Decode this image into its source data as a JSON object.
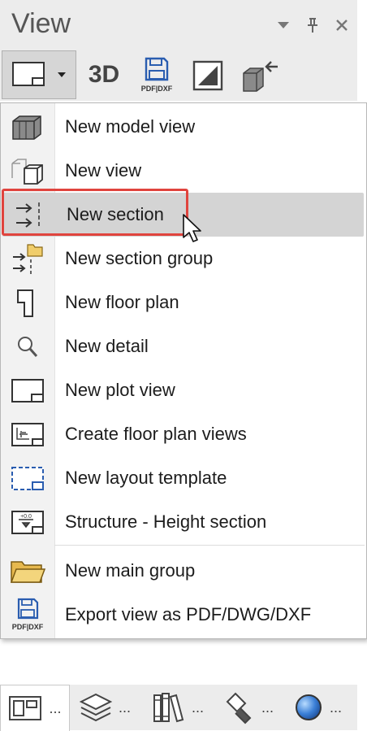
{
  "header": {
    "title": "View",
    "controls": [
      {
        "icon": "dropdown-arrow-icon"
      },
      {
        "icon": "pin-icon"
      },
      {
        "icon": "close-icon"
      }
    ]
  },
  "toolbar": {
    "three_d_label": "3D",
    "pdf_dxf_label": "PDF|DXF"
  },
  "menu": {
    "items": [
      {
        "label": "New model view",
        "icon": "model-view-icon"
      },
      {
        "label": "New view",
        "icon": "view-icon"
      },
      {
        "label": "New section",
        "icon": "section-icon",
        "highlighted": true
      },
      {
        "label": "New section group",
        "icon": "section-group-icon"
      },
      {
        "label": "New floor plan",
        "icon": "floor-plan-icon"
      },
      {
        "label": "New detail",
        "icon": "magnifier-icon"
      },
      {
        "label": "New plot view",
        "icon": "plot-view-icon"
      },
      {
        "label": "Create floor plan views",
        "icon": "floor-plan-views-icon"
      },
      {
        "label": "New layout template",
        "icon": "layout-template-icon"
      },
      {
        "label": "Structure - Height section",
        "icon": "height-section-icon"
      },
      {
        "label": "New main group",
        "icon": "folder-icon"
      },
      {
        "label": "Export view as PDF/DWG/DXF",
        "icon": "export-pdf-icon",
        "icon_caption": "PDF|DXF"
      }
    ]
  },
  "bottom_tabs": [
    {
      "icon": "views-panel-icon",
      "dots": "...",
      "active": true
    },
    {
      "icon": "layers-icon",
      "dots": "..."
    },
    {
      "icon": "library-icon",
      "dots": "..."
    },
    {
      "icon": "objects-icon",
      "dots": "..."
    },
    {
      "icon": "globe-icon",
      "dots": "..."
    }
  ],
  "colors": {
    "highlight": "#d4d4d4",
    "annotation_red": "#e0443e",
    "accent_blue": "#2a5db0"
  }
}
